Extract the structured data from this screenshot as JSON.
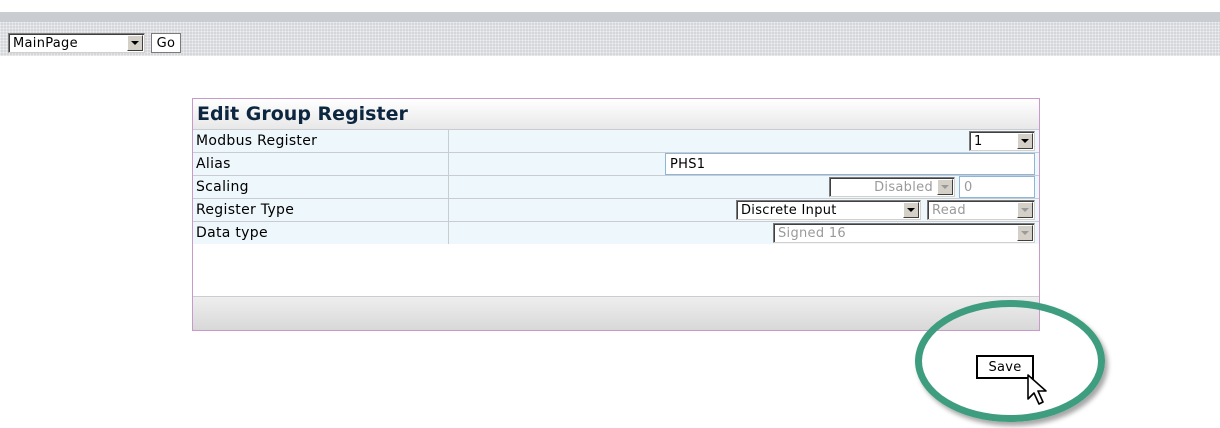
{
  "nav": {
    "page_select": "MainPage",
    "go_label": "Go"
  },
  "panel": {
    "title": "Edit Group Register",
    "rows": {
      "modbus_register": {
        "label": "Modbus Register",
        "value": "1"
      },
      "alias": {
        "label": "Alias",
        "value": "PHS1"
      },
      "scaling": {
        "label": "Scaling",
        "mode": "Disabled",
        "factor": "0"
      },
      "register_type": {
        "label": "Register Type",
        "type": "Discrete Input",
        "access": "Read"
      },
      "data_type": {
        "label": "Data type",
        "value": "Signed 16"
      }
    }
  },
  "actions": {
    "save_label": "Save"
  },
  "colors": {
    "highlight_ring": "#3f9d7f",
    "panel_border": "#c79ac9",
    "row_background": "#eef7fc",
    "title_text": "#0c2640"
  }
}
